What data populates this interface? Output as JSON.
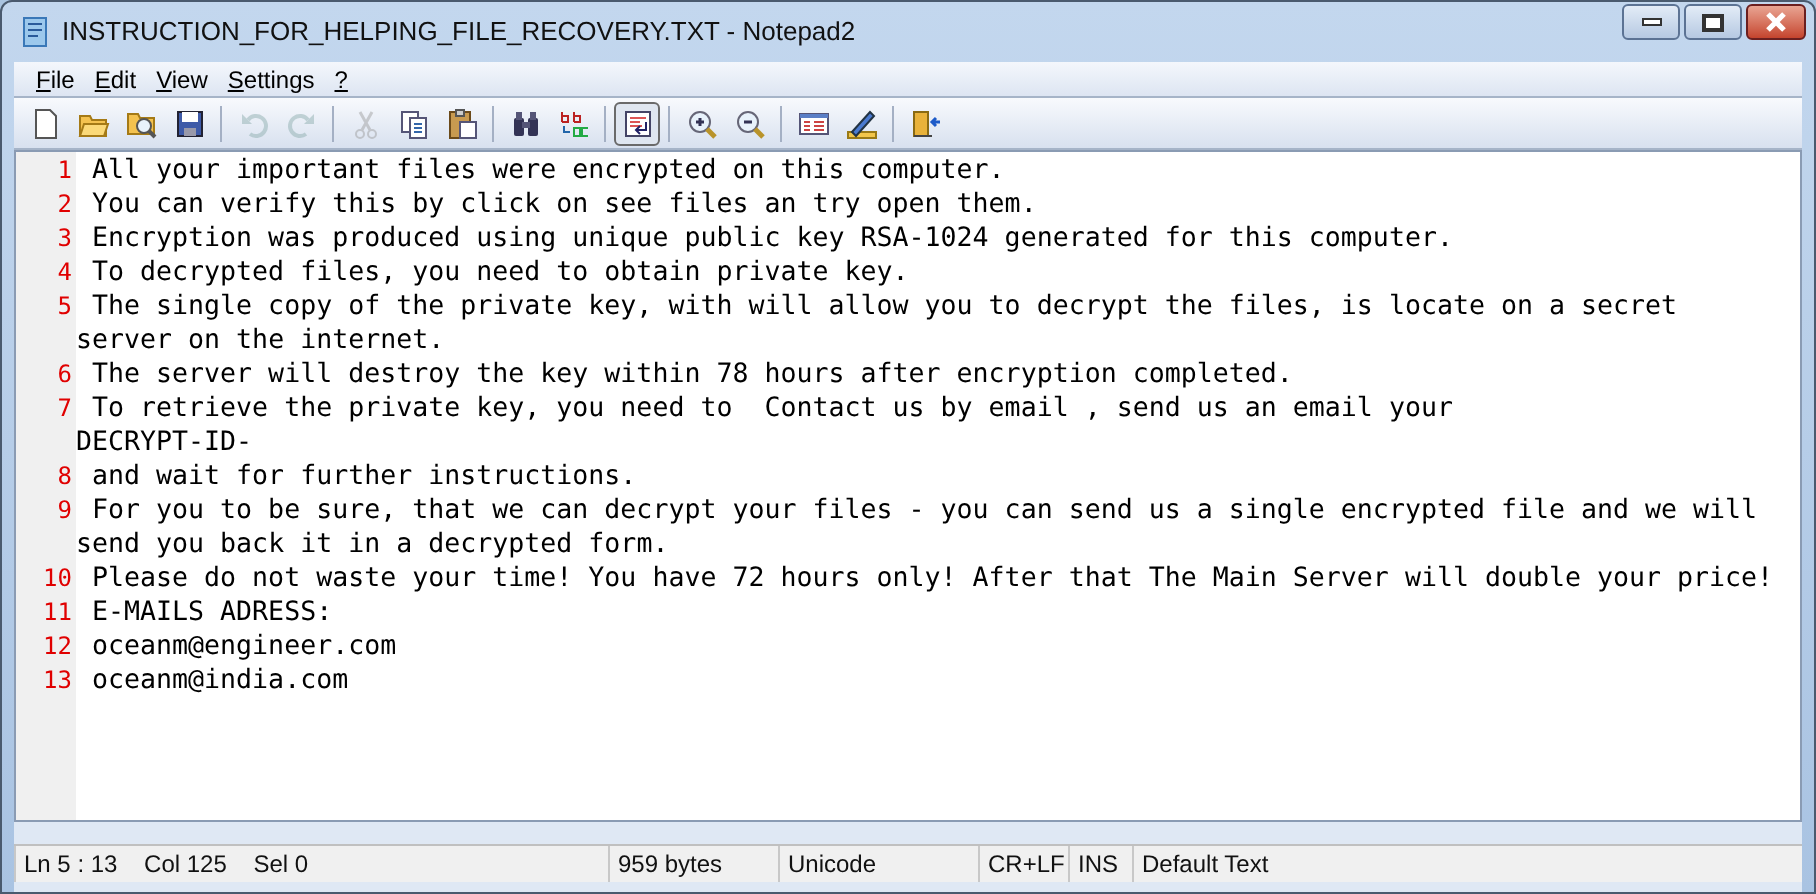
{
  "window": {
    "title": "INSTRUCTION_FOR_HELPING_FILE_RECOVERY.TXT - Notepad2"
  },
  "menu": [
    {
      "label": "File"
    },
    {
      "label": "Edit"
    },
    {
      "label": "View"
    },
    {
      "label": "Settings"
    },
    {
      "label": "?"
    }
  ],
  "toolbar": [
    {
      "kind": "new",
      "disabled": false,
      "pressed": false
    },
    {
      "kind": "open",
      "disabled": false,
      "pressed": false
    },
    {
      "kind": "browse",
      "disabled": false,
      "pressed": false
    },
    {
      "kind": "save",
      "disabled": false,
      "pressed": false
    },
    {
      "kind": "separator"
    },
    {
      "kind": "undo",
      "disabled": true,
      "pressed": false
    },
    {
      "kind": "redo",
      "disabled": true,
      "pressed": false
    },
    {
      "kind": "separator"
    },
    {
      "kind": "cut",
      "disabled": true,
      "pressed": false
    },
    {
      "kind": "copy",
      "disabled": false,
      "pressed": false
    },
    {
      "kind": "paste",
      "disabled": false,
      "pressed": false
    },
    {
      "kind": "separator"
    },
    {
      "kind": "find",
      "disabled": false,
      "pressed": false
    },
    {
      "kind": "replace",
      "disabled": false,
      "pressed": false
    },
    {
      "kind": "separator"
    },
    {
      "kind": "wrap",
      "disabled": false,
      "pressed": true
    },
    {
      "kind": "separator"
    },
    {
      "kind": "zoom_in",
      "disabled": false,
      "pressed": false
    },
    {
      "kind": "zoom_out",
      "disabled": false,
      "pressed": false
    },
    {
      "kind": "separator"
    },
    {
      "kind": "scheme",
      "disabled": false,
      "pressed": false
    },
    {
      "kind": "customize",
      "disabled": false,
      "pressed": false
    },
    {
      "kind": "separator"
    },
    {
      "kind": "exit",
      "disabled": false,
      "pressed": false
    }
  ],
  "editor": {
    "lines": [
      {
        "number": "1",
        "rows": [
          "All your important files were encrypted on this computer."
        ]
      },
      {
        "number": "2",
        "rows": [
          "You can verify this by click on see files an try open them."
        ]
      },
      {
        "number": "3",
        "rows": [
          "Encryption was produced using unique public key RSA-1024 generated for this computer."
        ]
      },
      {
        "number": "4",
        "rows": [
          "To decrypted files, you need to obtain private key."
        ]
      },
      {
        "number": "5",
        "rows": [
          "The single copy of the private key, with will allow you to decrypt the files, is locate on a secret",
          "server on the internet."
        ]
      },
      {
        "number": "6",
        "rows": [
          "The server will destroy the key within 78 hours after encryption completed."
        ]
      },
      {
        "number": "7",
        "rows": [
          "To retrieve the private key, you need to  Contact us by email , send us an email your",
          "DECRYPT-ID-"
        ]
      },
      {
        "number": "8",
        "rows": [
          "and wait for further instructions."
        ]
      },
      {
        "number": "9",
        "rows": [
          "For you to be sure, that we can decrypt your files - you can send us a single encrypted file and we will",
          "send you back it in a decrypted form."
        ]
      },
      {
        "number": "10",
        "rows": [
          "Please do not waste your time! You have 72 hours only! After that The Main Server will double your price!"
        ]
      },
      {
        "number": "11",
        "rows": [
          "E-MAILS ADRESS:"
        ]
      },
      {
        "number": "12",
        "rows": [
          "oceanm@engineer.com"
        ]
      },
      {
        "number": "13",
        "rows": [
          "oceanm@india.com"
        ]
      }
    ]
  },
  "status_bar": [
    {
      "text": "Ln 5 : 13    Col 125    Sel 0"
    },
    {
      "text": "959 bytes"
    },
    {
      "text": "Unicode"
    },
    {
      "text": "CR+LF"
    },
    {
      "text": "INS"
    },
    {
      "text": "Default Text"
    }
  ]
}
